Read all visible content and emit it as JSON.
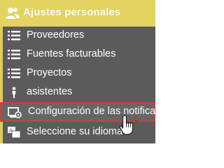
{
  "menu": {
    "title": "Ajustes personales",
    "items": [
      {
        "label": "Proveedores",
        "icon": "list-icon"
      },
      {
        "label": "Fuentes facturables",
        "icon": "list-icon"
      },
      {
        "label": "Proyectos",
        "icon": "list-icon"
      },
      {
        "label": "asistentes",
        "icon": "person-icon"
      },
      {
        "label": "Configuración de las notificaciones",
        "icon": "notification-settings-icon"
      },
      {
        "label": "Seleccione su idioma",
        "icon": "language-icon"
      }
    ],
    "active_index": 4
  },
  "colors": {
    "header_bg": "#e3d35f",
    "panel_bg": "#5b5b5b",
    "highlight_border": "#d83a3a"
  }
}
